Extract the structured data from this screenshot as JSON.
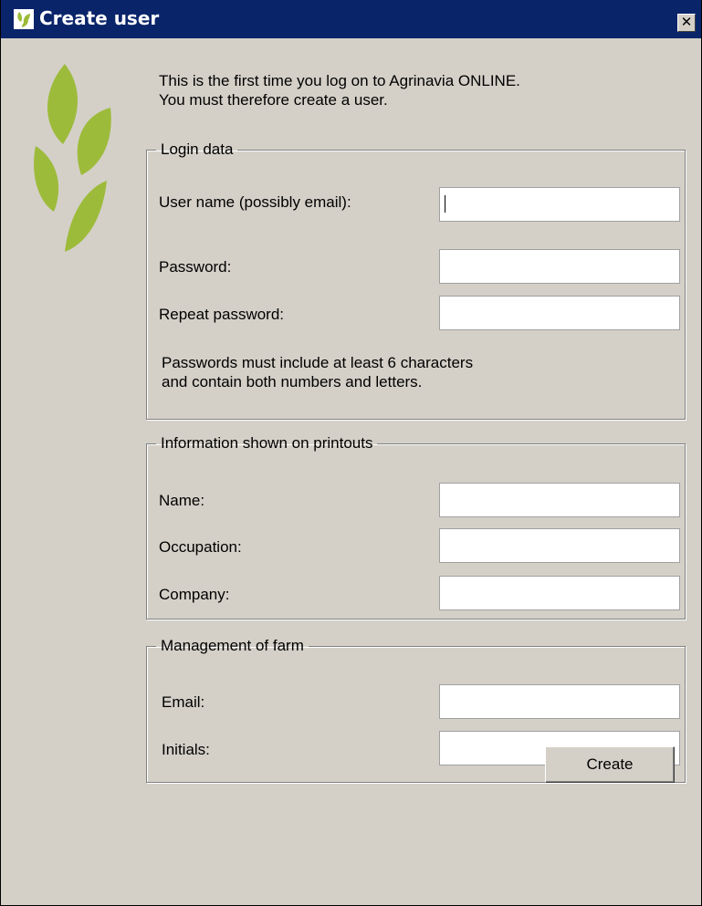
{
  "window": {
    "title": "Create user",
    "close_label": "✕"
  },
  "intro": {
    "line1": "This is the first time you log on to Agrinavia ONLINE.",
    "line2": "You must therefore create a user."
  },
  "login_group": {
    "legend": "Login data",
    "username_label": "User name (possibly email):",
    "username_value": "",
    "password_label": "Password:",
    "password_value": "",
    "repeat_password_label": "Repeat password:",
    "repeat_password_value": "",
    "note_line1": "Passwords must include at least 6 characters",
    "note_line2": "and contain both numbers and letters."
  },
  "printout_group": {
    "legend": "Information shown on printouts",
    "name_label": "Name:",
    "name_value": "",
    "occupation_label": "Occupation:",
    "occupation_value": "",
    "company_label": "Company:",
    "company_value": ""
  },
  "farm_group": {
    "legend": "Management of farm",
    "email_label": "Email:",
    "email_value": "",
    "initials_label": "Initials:",
    "initials_value": ""
  },
  "actions": {
    "create_label": "Create"
  },
  "colors": {
    "titlebar": "#0a246a",
    "dialog_bg": "#d4d0c8",
    "leaf_green": "#9dbb3a"
  },
  "icons": {
    "title_icon": "leaf-icon",
    "logo": "leaf-logo"
  }
}
